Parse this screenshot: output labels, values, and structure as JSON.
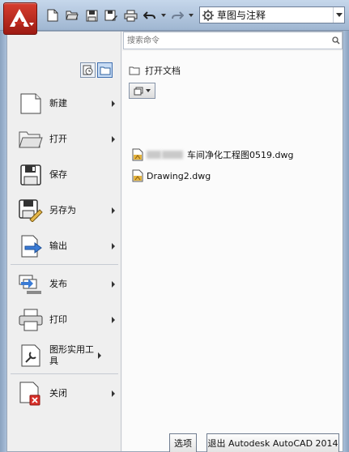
{
  "quick_access": {
    "icons": [
      "new-file-icon",
      "open-folder-icon",
      "save-icon",
      "save-as-icon",
      "print-icon",
      "undo-icon",
      "redo-icon"
    ]
  },
  "workspace": {
    "name": "草图与注释"
  },
  "search": {
    "placeholder": "搜索命令"
  },
  "menu": {
    "items": [
      {
        "key": "new",
        "label": "新建",
        "has_submenu": true
      },
      {
        "key": "open",
        "label": "打开",
        "has_submenu": true
      },
      {
        "key": "save",
        "label": "保存",
        "has_submenu": false
      },
      {
        "key": "saveas",
        "label": "另存为",
        "has_submenu": true
      },
      {
        "key": "export",
        "label": "输出",
        "has_submenu": true
      },
      {
        "key": "publish",
        "label": "发布",
        "has_submenu": true
      },
      {
        "key": "print",
        "label": "打印",
        "has_submenu": true
      },
      {
        "key": "utilities",
        "label": "图形实用工具",
        "has_submenu": true
      },
      {
        "key": "close",
        "label": "关闭",
        "has_submenu": true
      }
    ]
  },
  "right_pane": {
    "title": "打开文档",
    "documents": [
      {
        "name_visible": "车间净化工程图0519.dwg",
        "obscured_prefix": true
      },
      {
        "name_visible": "Drawing2.dwg",
        "obscured_prefix": false
      }
    ]
  },
  "buttons": {
    "options": "选项",
    "exit": "退出 Autodesk AutoCAD 2014"
  },
  "colors": {
    "app_button": "#c42b1f",
    "title_bar": "#b3c8e0",
    "menu_bg": "#f3f3f3",
    "selected_toggle": "#c8dcf4"
  }
}
